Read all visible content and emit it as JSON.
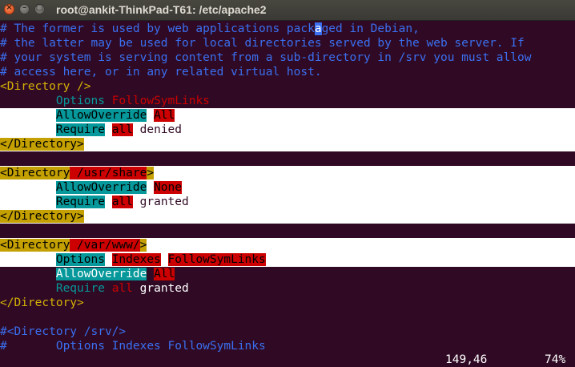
{
  "window": {
    "title": "root@ankit-ThinkPad-T61: /etc/apache2",
    "controls": {
      "close": "×",
      "minimize": "–",
      "maximize": "□"
    }
  },
  "lines": {
    "c1": "# The former is used by web applications packaged in Debian,",
    "c2": "# the latter may be used for local directories served by the web server. If",
    "c3": "# your system is serving content from a sub-directory in /srv you must allow",
    "c4": "# access here, or in any related virtual host.",
    "d1_open": "<Directory />",
    "d1_opt_kw": "Options",
    "d1_opt_val": "FollowSymLinks",
    "d1_ao_kw": "AllowOverride",
    "d1_ao_val": "All",
    "d1_req_kw": "Require",
    "d1_req_all": "all",
    "d1_req_val": "denied",
    "d1_close": "</Directory>",
    "d2_open_a": "<Directory",
    "d2_open_b": " /usr/share",
    "d2_open_c": ">",
    "d2_ao_kw": "AllowOverride",
    "d2_ao_val": "None",
    "d2_req_kw": "Require",
    "d2_req_all": "all",
    "d2_req_val": "granted",
    "d2_close": "</Directory>",
    "d3_open_a": "<Directory",
    "d3_open_b": " /var/www/",
    "d3_open_c": ">",
    "d3_opt_kw": "Options",
    "d3_opt_v1": "Indexes",
    "d3_opt_v2": "FollowSymLinks",
    "d3_ao_kw": "AllowOverride",
    "d3_ao_val": "All",
    "d3_req_kw": "Require",
    "d3_req_all": "all",
    "d3_req_val": "granted",
    "d3_close": "</Directory>",
    "c5": "#<Directory /srv/>",
    "c6_hash": "#",
    "c6_rest": "Options Indexes FollowSymLinks"
  },
  "status": {
    "position": "149,46",
    "percent": "74%"
  },
  "colors": {
    "background": "#300a24",
    "comment": "#3a6ff0",
    "tag": "#d4b106",
    "keyword": "#06989a",
    "value": "#cc0000",
    "selection": "#ffffff"
  }
}
